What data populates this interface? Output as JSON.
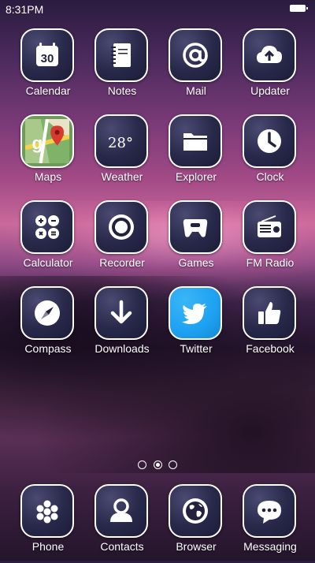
{
  "status_bar": {
    "time": "8:31PM"
  },
  "apps": [
    {
      "label": "Calendar",
      "icon": "calendar-icon",
      "badge": "30"
    },
    {
      "label": "Notes",
      "icon": "notes-icon"
    },
    {
      "label": "Mail",
      "icon": "at-sign-icon"
    },
    {
      "label": "Updater",
      "icon": "cloud-upload-icon"
    },
    {
      "label": "Maps",
      "icon": "maps-icon"
    },
    {
      "label": "Weather",
      "icon": "weather-icon",
      "badge": "28°"
    },
    {
      "label": "Explorer",
      "icon": "folder-icon"
    },
    {
      "label": "Clock",
      "icon": "clock-icon"
    },
    {
      "label": "Calculator",
      "icon": "calculator-icon"
    },
    {
      "label": "Recorder",
      "icon": "record-icon"
    },
    {
      "label": "Games",
      "icon": "gamepad-icon"
    },
    {
      "label": "FM Radio",
      "icon": "radio-icon"
    },
    {
      "label": "Compass",
      "icon": "compass-icon"
    },
    {
      "label": "Downloads",
      "icon": "download-arrow-icon"
    },
    {
      "label": "Twitter",
      "icon": "twitter-bird-icon"
    },
    {
      "label": "Facebook",
      "icon": "thumbs-up-icon"
    }
  ],
  "page_indicator": {
    "count": 3,
    "active": 2
  },
  "dock": [
    {
      "label": "Phone",
      "icon": "dialpad-icon"
    },
    {
      "label": "Contacts",
      "icon": "person-icon"
    },
    {
      "label": "Browser",
      "icon": "globe-icon"
    },
    {
      "label": "Messaging",
      "icon": "chat-bubble-icon"
    }
  ],
  "colors": {
    "icon_bg": "#2a2a4c",
    "twitter_bg": "#1da1f2",
    "maps_bg": "#6f9a5a"
  }
}
